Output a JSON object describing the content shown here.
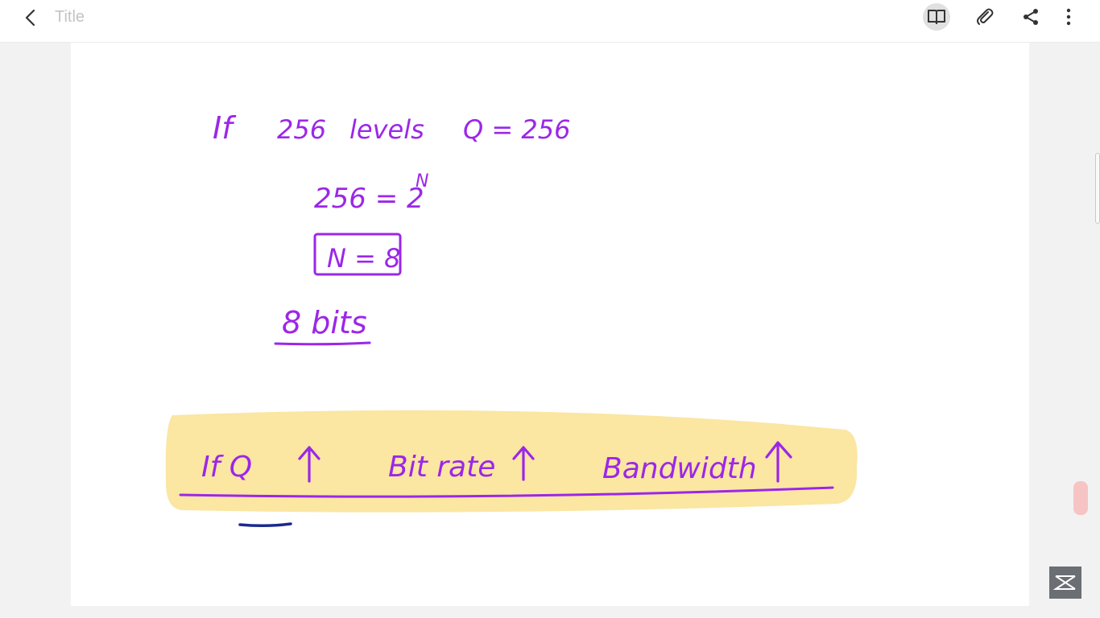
{
  "topbar": {
    "back_icon": "chevron-left-icon",
    "title": "Title",
    "tools": [
      {
        "name": "book-view-icon",
        "active": true
      },
      {
        "name": "attachment-icon",
        "active": false
      },
      {
        "name": "share-icon",
        "active": false
      },
      {
        "name": "more-icon",
        "active": false
      }
    ]
  },
  "note": {
    "line1": {
      "if": "If",
      "num": "256",
      "levels": "levels",
      "q_eq": "Q = 256"
    },
    "line2": {
      "lhs": "256 = 2",
      "exp": "N"
    },
    "boxed": "N = 8",
    "bits": "8 bits",
    "highlight": {
      "if_q": "If Q",
      "bit_rate": "Bit rate",
      "bandwidth": "Bandwidth"
    }
  },
  "colors": {
    "ink": "#9b27e8",
    "highlight": "#fbe6a2",
    "blue_mark": "#1b2a8c"
  },
  "watermark_icon": "logo-icon"
}
